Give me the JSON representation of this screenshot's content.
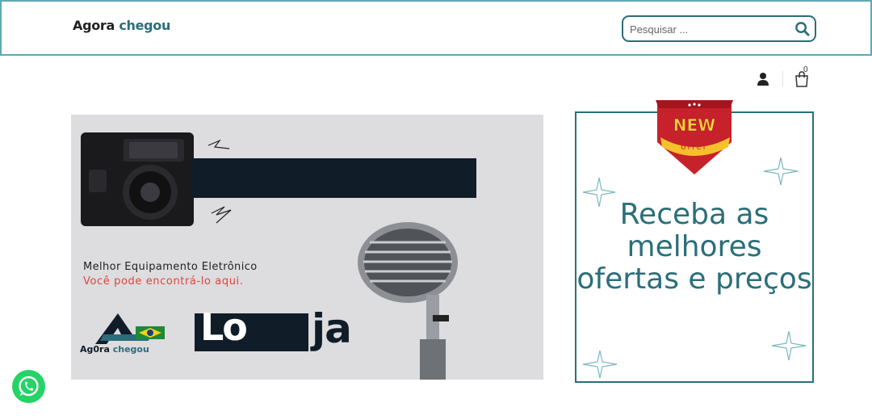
{
  "header": {
    "brand_part1": "Agora",
    "brand_part2": "chegou"
  },
  "search": {
    "placeholder": "Pesquisar ..."
  },
  "cart": {
    "count": "0"
  },
  "banner": {
    "line1": "Melhor Equipamento Eletrônico",
    "line2": "Você pode encontrá-lo aqui.",
    "loja_part1": "Lo",
    "loja_part2": "ja",
    "logo_part1": "Ag0ra",
    "logo_part2": "chegou"
  },
  "promo": {
    "text": "Receba as melhores ofertas e preços",
    "badge_top": "NEW",
    "badge_bottom": "offer"
  },
  "colors": {
    "accent": "#2b6e7a",
    "header_border": "#5fa8b3",
    "banner_bg": "#dddcdf",
    "dark": "#101d28",
    "red_text": "#e0453a",
    "whatsapp": "#25d366"
  },
  "icons": [
    "search-icon",
    "user-icon",
    "cart-icon",
    "whatsapp-icon",
    "sparkle-icon",
    "new-offer-badge"
  ]
}
